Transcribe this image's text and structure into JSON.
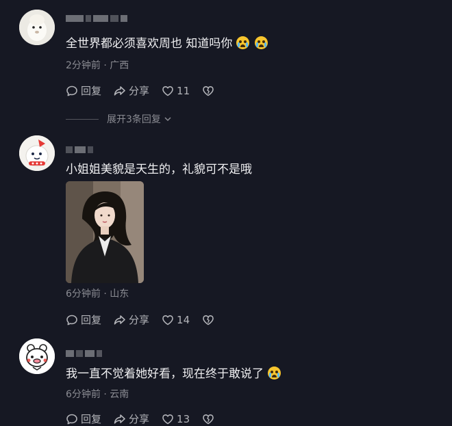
{
  "comments": [
    {
      "text": "全世界都必须喜欢周也 知道吗你",
      "meta": "2分钟前 · 广西",
      "reply_label": "回复",
      "share_label": "分享",
      "likes": "11",
      "expand_label": "展开3条回复"
    },
    {
      "text": "小姐姐美貌是天生的，礼貌可不是哦",
      "meta": "6分钟前 · 山东",
      "reply_label": "回复",
      "share_label": "分享",
      "likes": "14"
    },
    {
      "text": "我一直不觉着她好看，现在终于敢说了",
      "meta": "6分钟前 · 云南",
      "reply_label": "回复",
      "share_label": "分享",
      "likes": "13"
    }
  ],
  "icons": {
    "reply": "reply-bubble-icon",
    "share": "share-arrow-icon",
    "like": "heart-icon",
    "dislike": "broken-heart-icon",
    "emoji": "crying-face-emoji",
    "expand": "chevron-down-icon"
  },
  "colors": {
    "background": "#161823",
    "text": "#f0f0f2",
    "meta": "#8b8c93"
  }
}
